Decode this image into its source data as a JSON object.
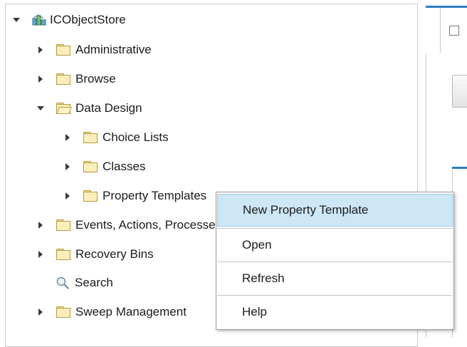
{
  "tree": {
    "root": {
      "label": "ICObjectStore"
    },
    "items": [
      {
        "label": "Administrative"
      },
      {
        "label": "Browse"
      },
      {
        "label": "Data Design"
      },
      {
        "label": "Choice Lists"
      },
      {
        "label": "Classes"
      },
      {
        "label": "Property Templates"
      },
      {
        "label": "Events, Actions, Processes"
      },
      {
        "label": "Recovery Bins"
      },
      {
        "label": "Search"
      },
      {
        "label": "Sweep Management"
      }
    ]
  },
  "context_menu": {
    "items": [
      {
        "label": "New Property Template",
        "highlighted": true
      },
      {
        "label": "Open"
      },
      {
        "label": "Refresh"
      },
      {
        "label": "Help"
      }
    ]
  },
  "icons": {
    "expand": "triangle-right-icon",
    "collapse": "triangle-down-icon",
    "folder": "folder-icon",
    "folder_open": "folder-open-icon",
    "object_store": "object-store-icon",
    "search": "magnifier-icon"
  },
  "colors": {
    "highlight": "#cde7f7",
    "accent": "#2e7dbd",
    "folder": "#fbeebb"
  }
}
